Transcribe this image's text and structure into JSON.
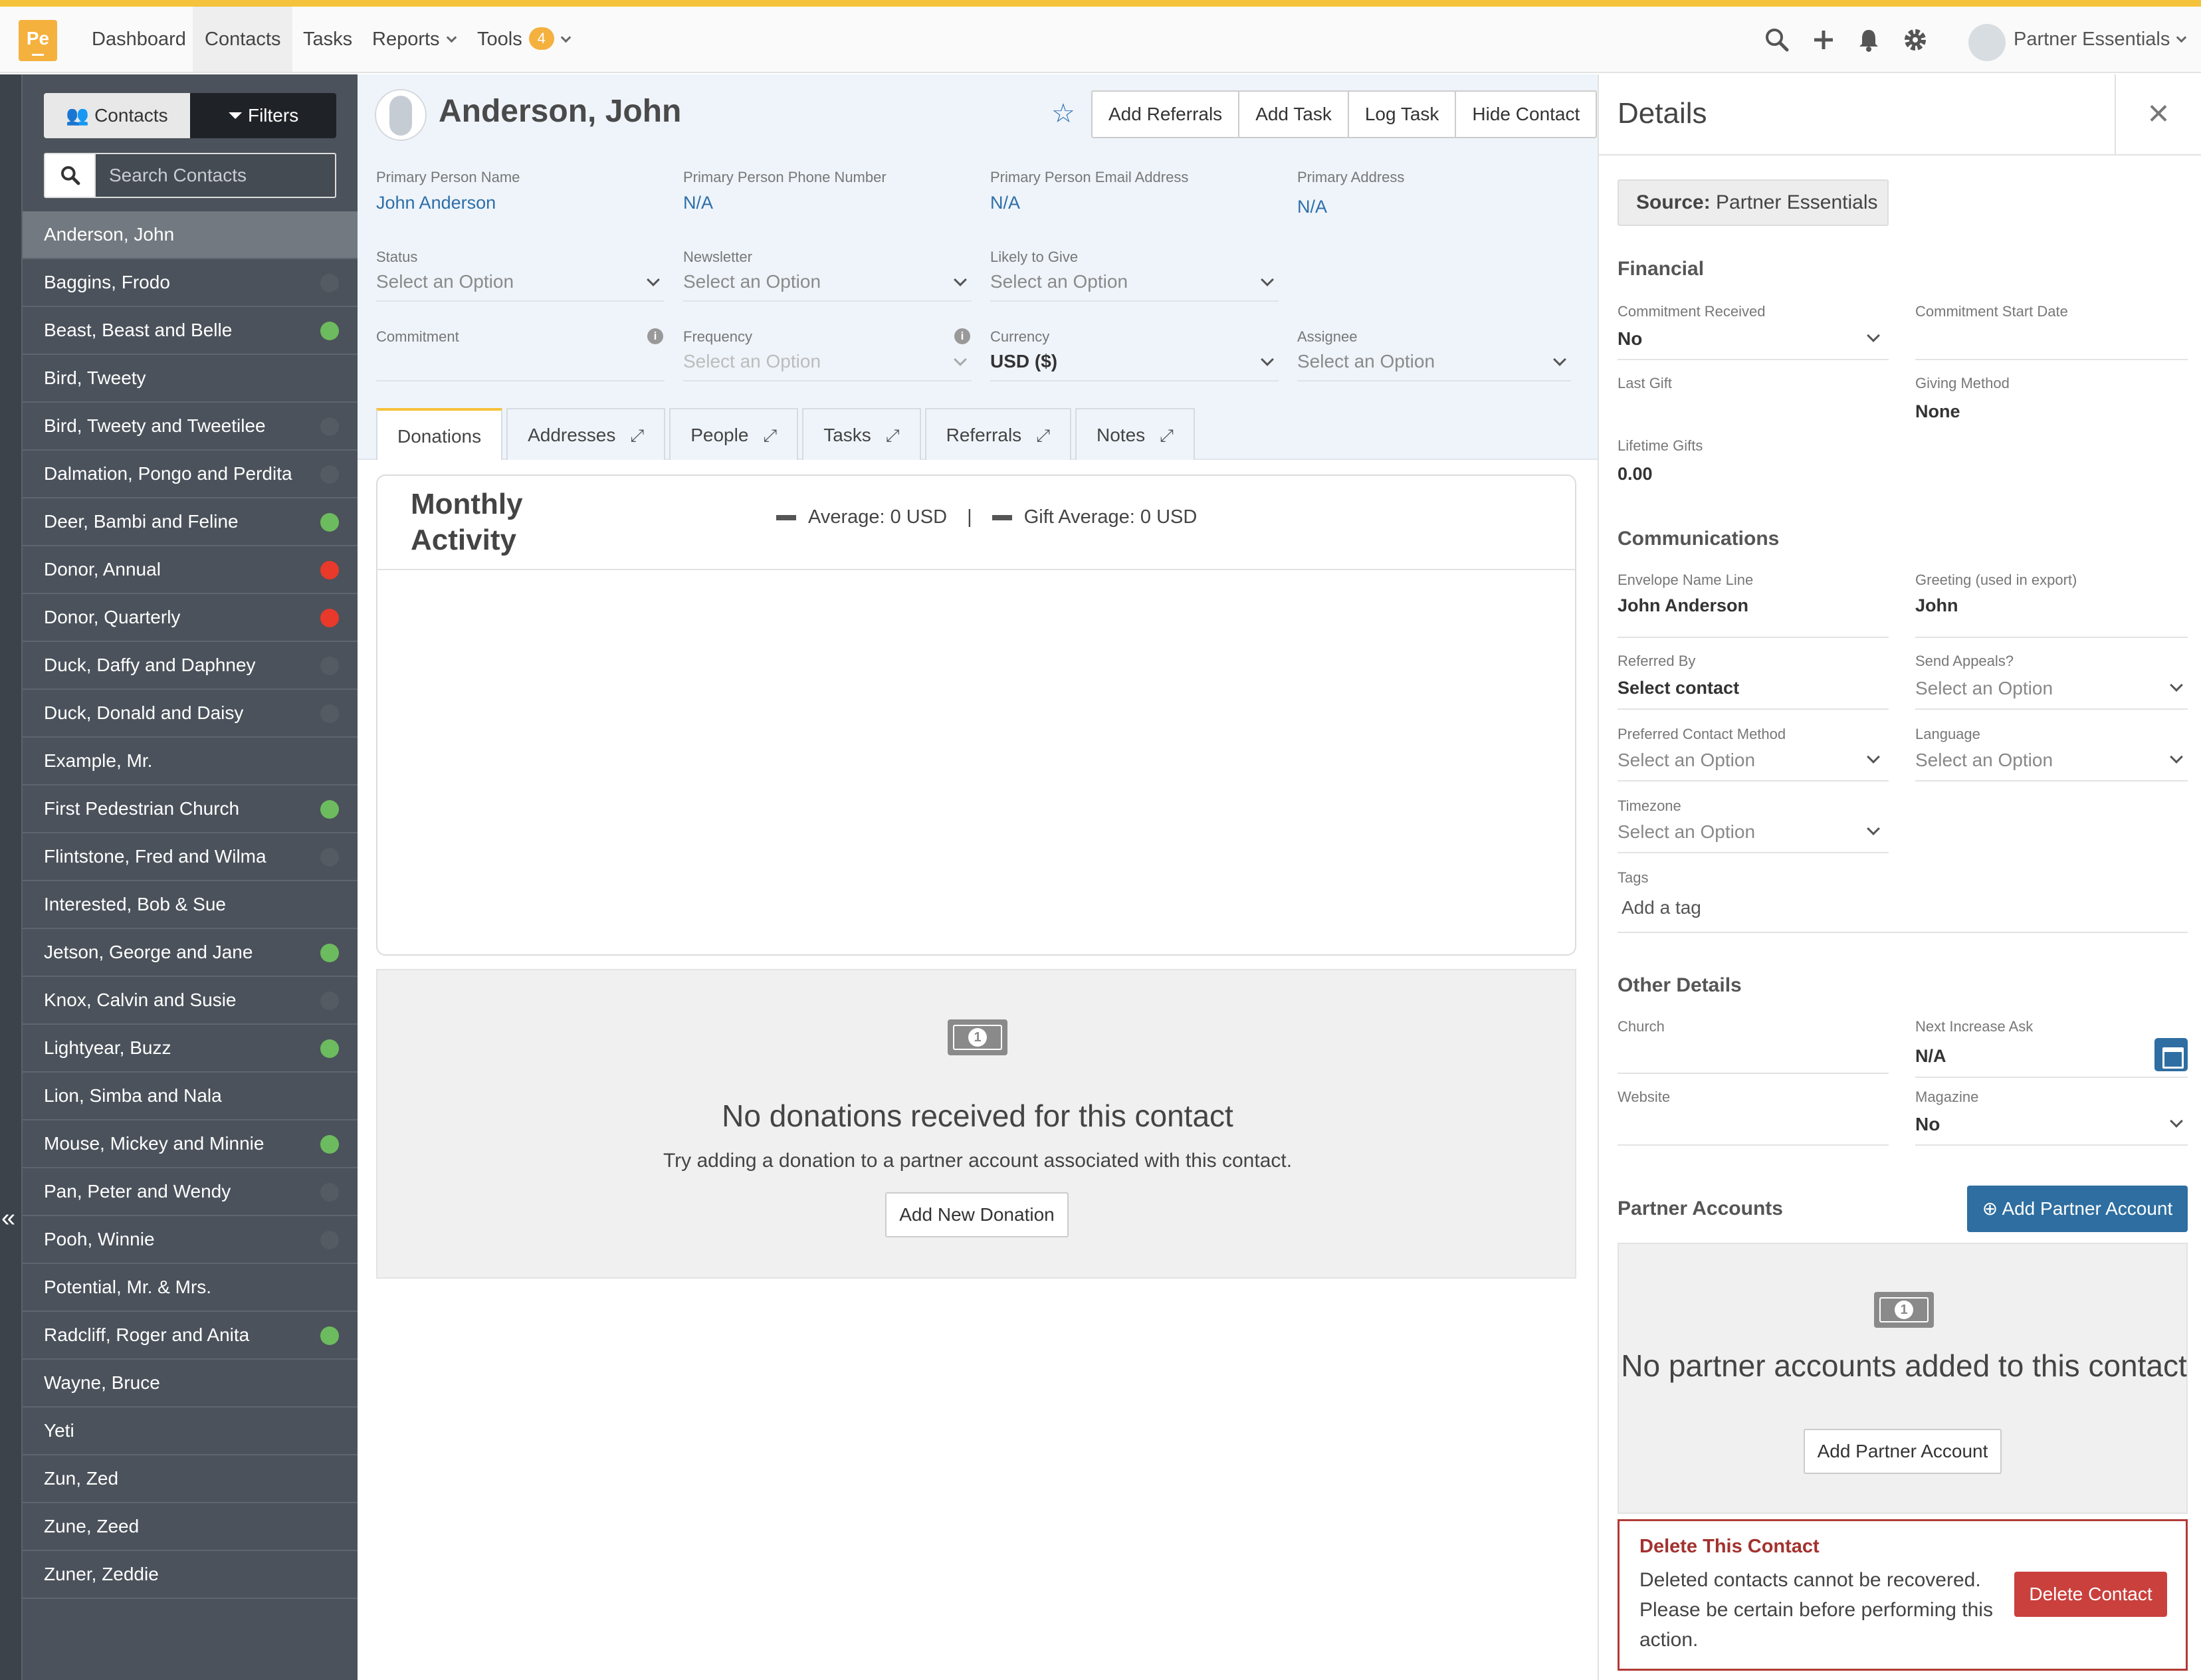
{
  "topnav": {
    "logo_text": "Pe",
    "items": [
      "Dashboard",
      "Contacts",
      "Tasks",
      "Reports",
      "Tools"
    ],
    "tools_badge": "4",
    "user_name": "Partner Essentials",
    "icons": [
      "search-icon",
      "plus-icon",
      "bell-icon",
      "gear-icon"
    ]
  },
  "sidebar": {
    "toggle_contacts": "Contacts",
    "toggle_filters": "Filters",
    "search_placeholder": "Search Contacts",
    "contacts": [
      {
        "name": "Anderson, John",
        "status": "none"
      },
      {
        "name": "Baggins, Frodo",
        "status": "grey"
      },
      {
        "name": "Beast, Beast and Belle",
        "status": "green"
      },
      {
        "name": "Bird, Tweety",
        "status": "none"
      },
      {
        "name": "Bird, Tweety and Tweetilee",
        "status": "grey"
      },
      {
        "name": "Dalmation, Pongo and Perdita",
        "status": "grey"
      },
      {
        "name": "Deer, Bambi and Feline",
        "status": "green"
      },
      {
        "name": "Donor, Annual",
        "status": "red"
      },
      {
        "name": "Donor, Quarterly",
        "status": "red"
      },
      {
        "name": "Duck, Daffy and Daphney",
        "status": "grey"
      },
      {
        "name": "Duck, Donald and Daisy",
        "status": "grey"
      },
      {
        "name": "Example, Mr.",
        "status": "none"
      },
      {
        "name": "First Pedestrian Church",
        "status": "green"
      },
      {
        "name": "Flintstone, Fred and Wilma",
        "status": "grey"
      },
      {
        "name": "Interested, Bob & Sue",
        "status": "none"
      },
      {
        "name": "Jetson, George and Jane",
        "status": "green"
      },
      {
        "name": "Knox, Calvin and Susie",
        "status": "grey"
      },
      {
        "name": "Lightyear, Buzz",
        "status": "green"
      },
      {
        "name": "Lion, Simba and Nala",
        "status": "none"
      },
      {
        "name": "Mouse, Mickey and Minnie",
        "status": "green"
      },
      {
        "name": "Pan, Peter and Wendy",
        "status": "grey"
      },
      {
        "name": "Pooh, Winnie",
        "status": "grey"
      },
      {
        "name": "Potential, Mr. & Mrs.",
        "status": "none"
      },
      {
        "name": "Radcliff, Roger and Anita",
        "status": "green"
      },
      {
        "name": "Wayne, Bruce",
        "status": "none"
      },
      {
        "name": "Yeti",
        "status": "none"
      },
      {
        "name": "Zun, Zed",
        "status": "none"
      },
      {
        "name": "Zune, Zeed",
        "status": "none"
      },
      {
        "name": "Zuner, Zeddie",
        "status": "none"
      }
    ],
    "status_colors": {
      "green": "#6dbb5f",
      "red": "#e8392a",
      "grey": "#555b63"
    }
  },
  "contact": {
    "name": "Anderson, John",
    "actions": [
      "Add Referrals",
      "Add Task",
      "Log Task",
      "Hide Contact"
    ],
    "fields": {
      "primary_person_label": "Primary Person Name",
      "primary_person_value": "John Anderson",
      "phone_label": "Primary Person Phone Number",
      "phone_value": "N/A",
      "email_label": "Primary Person Email Address",
      "email_value": "N/A",
      "address_label": "Primary Address",
      "address_value": "N/A",
      "status_label": "Status",
      "status_value": "Select an Option",
      "newsletter_label": "Newsletter",
      "newsletter_value": "Select an Option",
      "likely_label": "Likely to Give",
      "likely_value": "Select an Option",
      "commitment_label": "Commitment",
      "frequency_label": "Frequency",
      "frequency_value": "Select an Option",
      "currency_label": "Currency",
      "currency_value": "USD ($)",
      "assignee_label": "Assignee",
      "assignee_value": "Select an Option"
    },
    "tabs": [
      "Donations",
      "Addresses",
      "People",
      "Tasks",
      "Referrals",
      "Notes"
    ]
  },
  "chart": {
    "title": "Monthly Activity",
    "legend_average": "Average: 0 USD",
    "legend_separator": "|",
    "legend_gift_average": "Gift Average: 0 USD"
  },
  "donations_empty": {
    "title": "No donations received for this contact",
    "subtitle": "Try adding a donation to a partner account associated with this contact.",
    "button": "Add New Donation"
  },
  "details": {
    "title": "Details",
    "close": "×",
    "source_label": "Source:",
    "source_value": "Partner Essentials",
    "financial": {
      "heading": "Financial",
      "commitment_received_label": "Commitment Received",
      "commitment_received_value": "No",
      "commitment_start_label": "Commitment Start Date",
      "last_gift_label": "Last Gift",
      "giving_method_label": "Giving Method",
      "giving_method_value": "None",
      "lifetime_label": "Lifetime Gifts",
      "lifetime_value": "0.00"
    },
    "communications": {
      "heading": "Communications",
      "envelope_label": "Envelope Name Line",
      "envelope_value": "John Anderson",
      "greeting_label": "Greeting (used in export)",
      "greeting_value": "John",
      "referred_label": "Referred By",
      "referred_value": "Select contact",
      "appeals_label": "Send Appeals?",
      "appeals_value": "Select an Option",
      "contact_method_label": "Preferred Contact Method",
      "contact_method_value": "Select an Option",
      "language_label": "Language",
      "language_value": "Select an Option",
      "timezone_label": "Timezone",
      "timezone_value": "Select an Option",
      "tags_label": "Tags",
      "tags_placeholder": "Add a tag"
    },
    "other": {
      "heading": "Other Details",
      "church_label": "Church",
      "next_increase_label": "Next Increase Ask",
      "next_increase_value": "N/A",
      "website_label": "Website",
      "magazine_label": "Magazine",
      "magazine_value": "No"
    },
    "partner_accounts": {
      "heading": "Partner Accounts",
      "add_button": "Add Partner Account",
      "empty_title": "No partner accounts added to this contact",
      "empty_button": "Add Partner Account"
    },
    "delete": {
      "title": "Delete This Contact",
      "text": "Deleted contacts cannot be recovered. Please be certain before performing this action.",
      "button": "Delete Contact"
    }
  }
}
